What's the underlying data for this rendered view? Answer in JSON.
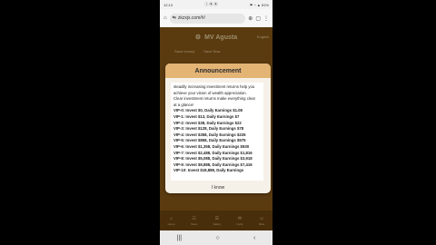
{
  "status": {
    "time": "12:13",
    "icons": "ⓘ ▣ ▣",
    "right": "⚑ ◔ ▲ 81%"
  },
  "browser": {
    "url": "zkzxjs.com/#/"
  },
  "app": {
    "title": "MV Agusta",
    "header_right": "English",
    "action_1": "Save money",
    "action_2": "Save Now"
  },
  "modal": {
    "title": "Announcement",
    "intro_lines": [
      "steadily increasing investment returns help you",
      "achieve your vision of wealth appreciation.",
      "Clear investment returns make everything clear",
      "at a glance!"
    ],
    "vip_lines": [
      "VIP-0: Invest $0, Daily Earnings $1.08",
      "VIP-1: Invest $13, Daily Earnings $7",
      "VIP-2: Invest $38, Daily Earnings $22",
      "VIP-3: Invest $128, Daily Earnings $78",
      "VIP-4: Invest $358, Daily Earnings $226",
      "VIP-5: Invest $858, Daily Earnings $575",
      "VIP-6: Invest $1,358, Daily Earnings $930",
      "VIP-7: Invest $2,488, Daily Earnings $1,816",
      "VIP-8: Invest $5,088, Daily Earnings $3,918",
      "VIP-9: Invest $9,888, Daily Earnings $7,416",
      "VIP-10: Invest $18,888, Daily Earnings"
    ],
    "ok_label": "I know"
  },
  "nav": {
    "items": [
      "Home",
      "Team",
      "Salary",
      "Invite",
      "Mine"
    ]
  },
  "sysnav": {
    "recent": "|||",
    "home": "○",
    "back": "‹"
  }
}
